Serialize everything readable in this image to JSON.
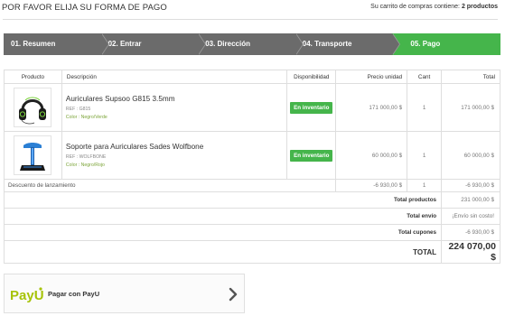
{
  "header": {
    "title": "POR FAVOR ELIJA SU FORMA DE PAGO",
    "cart_prefix": "Su carrito de compras contiene: ",
    "cart_count": "2 productos"
  },
  "steps": [
    {
      "label": "01. Resumen",
      "active": false
    },
    {
      "label": "02. Entrar",
      "active": false
    },
    {
      "label": "03. Dirección",
      "active": false
    },
    {
      "label": "04. Transporte",
      "active": false
    },
    {
      "label": "05. Pago",
      "active": true
    }
  ],
  "colors": {
    "step_inactive": "#6b6b6b",
    "step_active": "#45b54b",
    "badge": "#45b54b",
    "item_color_text": "#7aa336"
  },
  "table": {
    "headers": {
      "product": "Producto",
      "description": "Descripción",
      "availability": "Disponibilidad",
      "unit_price": "Precio unidad",
      "qty": "Cant",
      "total": "Total"
    },
    "items": [
      {
        "name": "Auriculares Supsoo G815 3.5mm",
        "ref": "REF : G815",
        "color": "Color : Negro/Verde",
        "availability": "En inventario",
        "unit_price": "171 000,00 $",
        "qty": "1",
        "total": "171 000,00 $",
        "image": "headphones-image"
      },
      {
        "name": "Soporte para Auriculares Sades Wolfbone",
        "ref": "REF : WOLFBONE",
        "color": "Color : Negro/Rojo",
        "availability": "En inventario",
        "unit_price": "60 000,00 $",
        "qty": "1",
        "total": "60 000,00 $",
        "image": "headphone-stand-image"
      }
    ],
    "discount": {
      "label": "Descuento de lanzamiento",
      "unit_price": "-6 930,00 $",
      "qty": "1",
      "total": "-6 930,00 $"
    },
    "summary": [
      {
        "label": "Total productos",
        "value": "231 000,00 $"
      },
      {
        "label": "Total envío",
        "value": "¡Envío sin costo!"
      },
      {
        "label": "Total cupones",
        "value": "-6 930,00 $"
      }
    ],
    "grand_total": {
      "label": "TOTAL",
      "value": "224 070,00 $"
    }
  },
  "payment": {
    "logo_text": "PayU",
    "label": "Pagar con PayU",
    "icon": "chevron-right-icon"
  }
}
